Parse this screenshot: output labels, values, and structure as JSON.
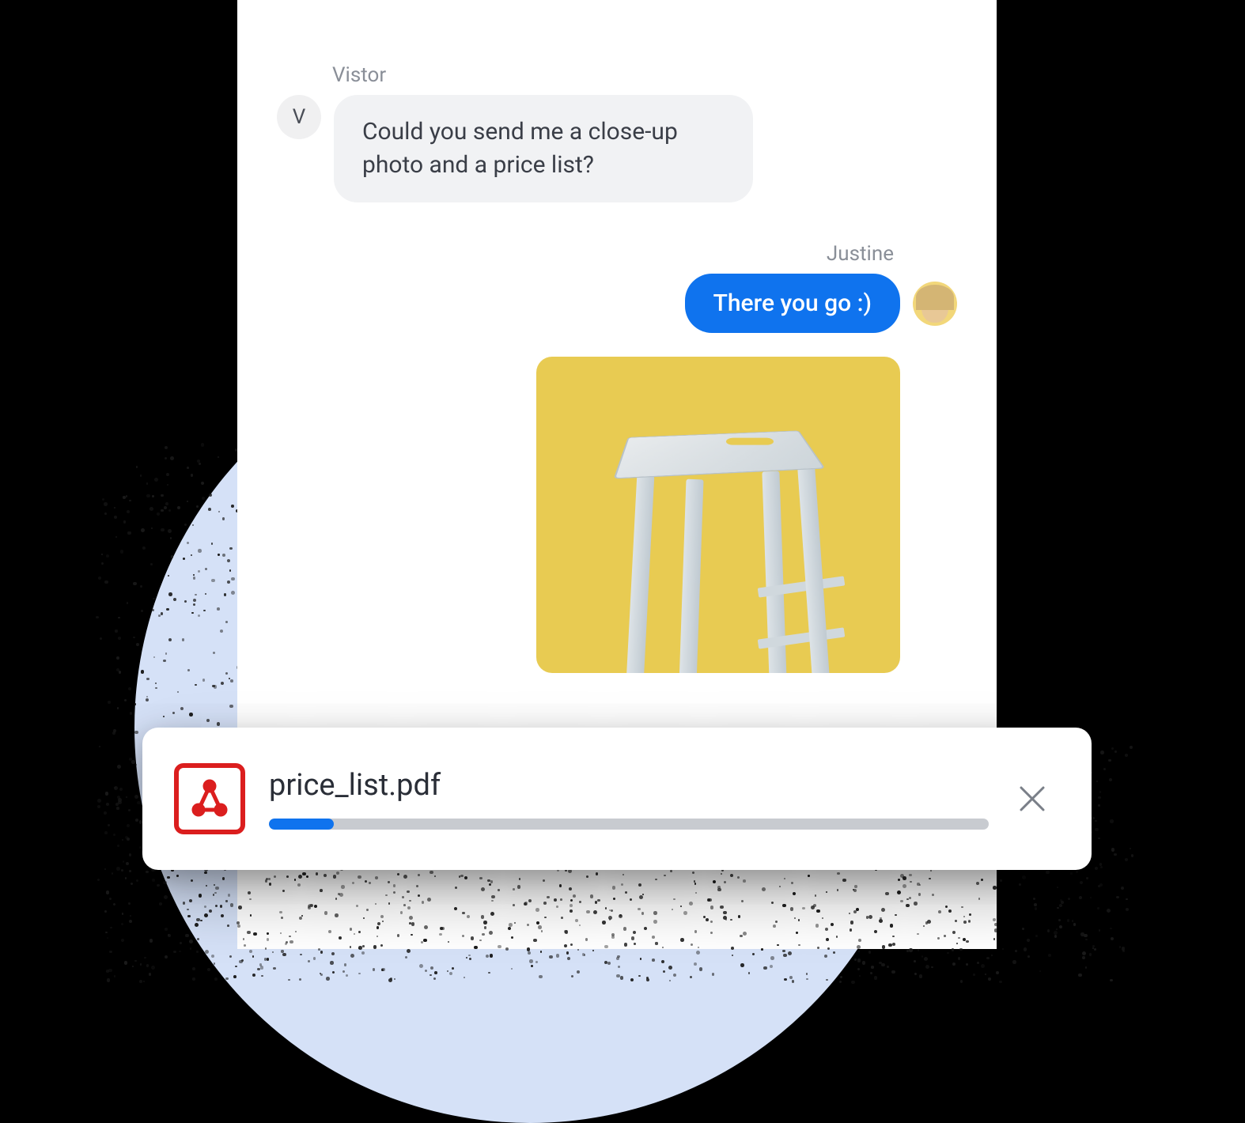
{
  "visitor": {
    "label": "Vistor",
    "avatar_initial": "V",
    "message": "Could you send me a close-up photo and a price list?"
  },
  "agent": {
    "label": "Justine",
    "message": "There you go :)"
  },
  "attachment": {
    "alt": "white-wooden-stool-product-photo"
  },
  "upload": {
    "filename": "price_list.pdf",
    "progress_percent": 9,
    "icon": "pdf-icon"
  },
  "colors": {
    "accent": "#0f73ee",
    "pdf_red": "#db1e1e",
    "bg_circle": "#d5e1f7",
    "visitor_bubble": "#f1f2f4"
  }
}
